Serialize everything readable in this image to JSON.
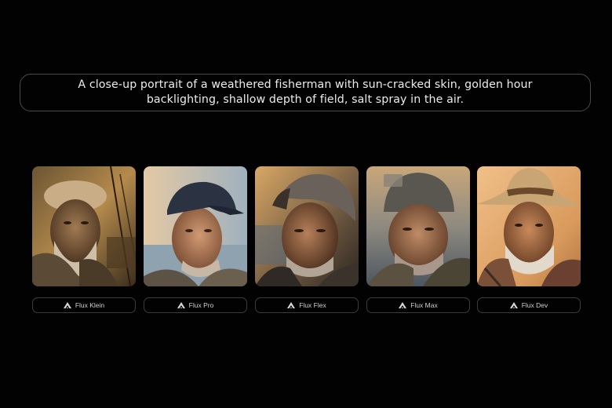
{
  "prompt": {
    "text": "A close-up portrait of a weathered fisherman with sun-cracked skin, golden hour backlighting, shallow depth of field, salt spray in the air."
  },
  "models": [
    {
      "label": "Flux Klein",
      "icon": "flux-logo-icon"
    },
    {
      "label": "Flux Pro",
      "icon": "flux-logo-icon"
    },
    {
      "label": "Flux Flex",
      "icon": "flux-logo-icon"
    },
    {
      "label": "Flux Max",
      "icon": "flux-logo-icon"
    },
    {
      "label": "Flux Dev",
      "icon": "flux-logo-icon"
    }
  ],
  "colors": {
    "background": "#020202",
    "border": "#4a4a4a",
    "text": "#ececec"
  }
}
